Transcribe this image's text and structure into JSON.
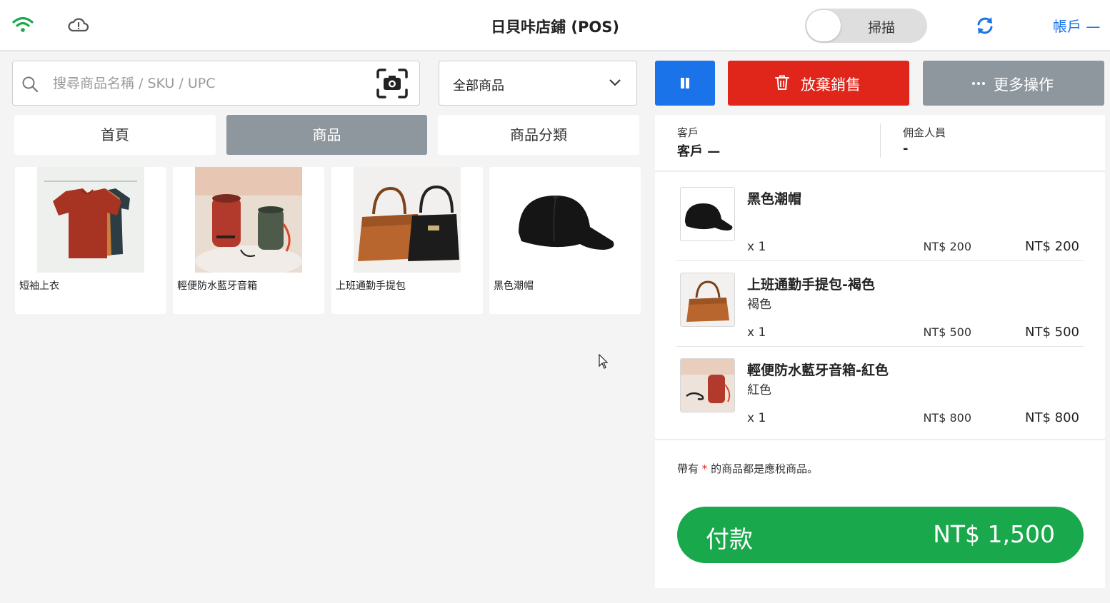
{
  "topbar": {
    "title": "日貝咔店鋪 (POS)",
    "scan_label": "掃描",
    "account_label": "帳戶 —",
    "icons": [
      "wifi-icon",
      "cloud-alert-icon",
      "refresh-icon"
    ],
    "wifi_color": "#1aa84c"
  },
  "search": {
    "placeholder": "搜尋商品名稱 / SKU / UPC"
  },
  "category_select": {
    "value": "全部商品"
  },
  "tabs": [
    {
      "label": "首頁",
      "active": false
    },
    {
      "label": "商品",
      "active": true
    },
    {
      "label": "商品分類",
      "active": false
    }
  ],
  "products": [
    {
      "name": "短袖上衣"
    },
    {
      "name": "輕便防水藍牙音箱"
    },
    {
      "name": "上班通勤手提包"
    },
    {
      "name": "黑色潮帽"
    }
  ],
  "actions": {
    "discard_label": "放棄銷售",
    "more_label": "更多操作"
  },
  "cart": {
    "customer_label": "客戶",
    "customer_value": "客戶 —",
    "commission_label": "佣金人員",
    "commission_value": "-",
    "items": [
      {
        "name": "黑色潮帽",
        "variant": "",
        "qty": "x 1",
        "unit_price": "NT$ 200",
        "total": "NT$ 200"
      },
      {
        "name": "上班通勤手提包-褐色",
        "variant": "褐色",
        "qty": "x 1",
        "unit_price": "NT$ 500",
        "total": "NT$ 500"
      },
      {
        "name": "輕便防水藍牙音箱-紅色",
        "variant": "紅色",
        "qty": "x 1",
        "unit_price": "NT$ 800",
        "total": "NT$ 800"
      }
    ],
    "tax_note_before": "帶有",
    "tax_note_star": "*",
    "tax_note_after": "的商品都是應稅商品。",
    "pay_label": "付款",
    "pay_amount": "NT$ 1,500"
  },
  "colors": {
    "primary_blue": "#1a73e8",
    "discard_red": "#e0261b",
    "pay_green": "#1aa84c",
    "neutral_gray": "#8f979e"
  }
}
